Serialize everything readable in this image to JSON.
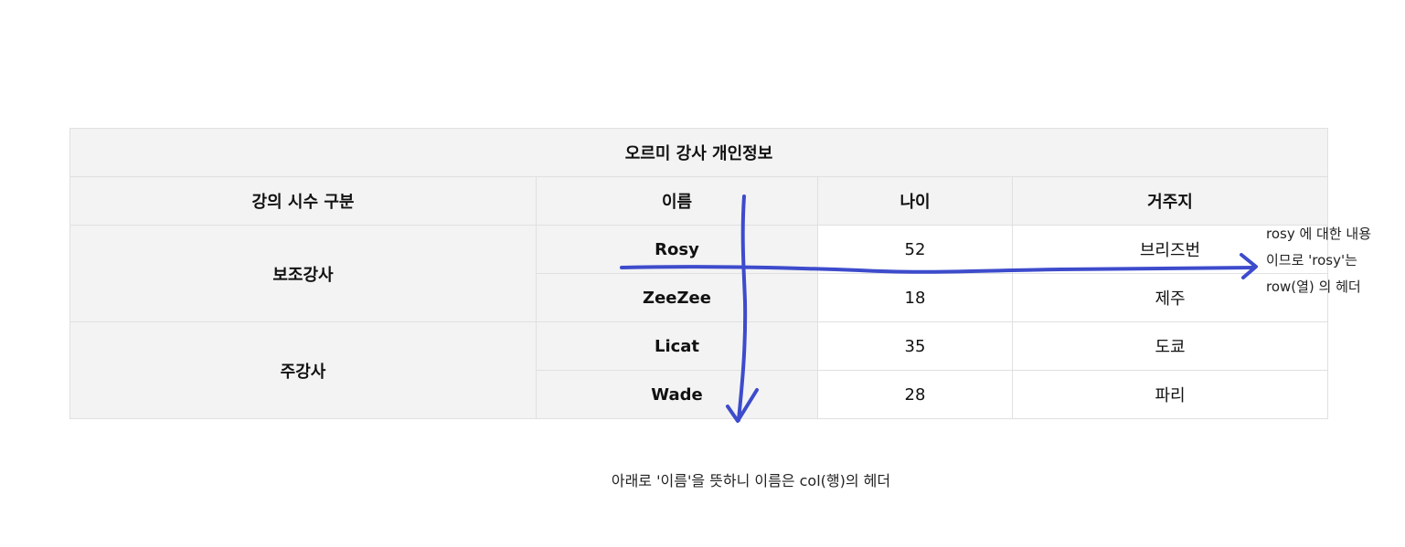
{
  "table": {
    "caption": "오르미 강사 개인정보",
    "headers": [
      "강의 시수 구분",
      "이름",
      "나이",
      "거주지"
    ],
    "groups": [
      {
        "label": "보조강사",
        "rows": [
          {
            "name": "Rosy",
            "age": "52",
            "residence": "브리즈번"
          },
          {
            "name": "ZeeZee",
            "age": "18",
            "residence": "제주"
          }
        ]
      },
      {
        "label": "주강사",
        "rows": [
          {
            "name": "Licat",
            "age": "35",
            "residence": "도쿄"
          },
          {
            "name": "Wade",
            "age": "28",
            "residence": "파리"
          }
        ]
      }
    ]
  },
  "annotations": {
    "right_note_lines": [
      "rosy 에 대한 내용",
      "이므로 'rosy'는",
      "row(열) 의 헤더"
    ],
    "bottom_note": "아래로 '이름'을 뜻하니 이름은 col(행)의 헤더",
    "pen_color": "#3d4bcc"
  }
}
